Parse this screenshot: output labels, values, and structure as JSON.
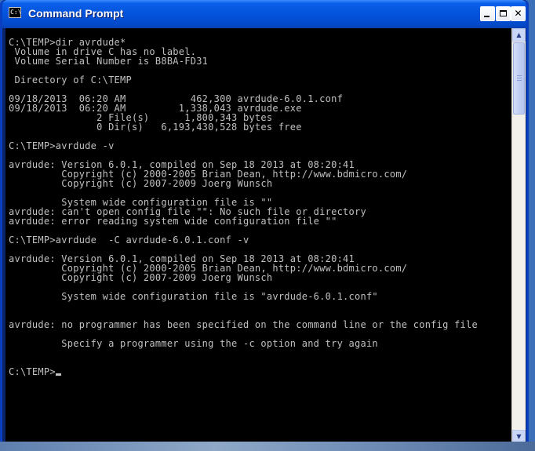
{
  "window": {
    "title": "Command Prompt",
    "icon_name": "cmd-icon",
    "icon_glyph": "C:\\",
    "buttons": {
      "minimize": "minimize-icon",
      "maximize": "maximize-icon",
      "close": "close-icon",
      "close_glyph": "✕"
    }
  },
  "console": {
    "foreground": "#c0c0c0",
    "background": "#000000",
    "lines": [
      "C:\\TEMP>dir avrdude*",
      " Volume in drive C has no label.",
      " Volume Serial Number is B8BA-FD31",
      "",
      " Directory of C:\\TEMP",
      "",
      "09/18/2013  06:20 AM           462,300 avrdude-6.0.1.conf",
      "09/18/2013  06:20 AM         1,338,043 avrdude.exe",
      "               2 File(s)      1,800,343 bytes",
      "               0 Dir(s)   6,193,430,528 bytes free",
      "",
      "C:\\TEMP>avrdude -v",
      "",
      "avrdude: Version 6.0.1, compiled on Sep 18 2013 at 08:20:41",
      "         Copyright (c) 2000-2005 Brian Dean, http://www.bdmicro.com/",
      "         Copyright (c) 2007-2009 Joerg Wunsch",
      "",
      "         System wide configuration file is \"\"",
      "avrdude: can't open config file \"\": No such file or directory",
      "avrdude: error reading system wide configuration file \"\"",
      "",
      "C:\\TEMP>avrdude  -C avrdude-6.0.1.conf -v",
      "",
      "avrdude: Version 6.0.1, compiled on Sep 18 2013 at 08:20:41",
      "         Copyright (c) 2000-2005 Brian Dean, http://www.bdmicro.com/",
      "         Copyright (c) 2007-2009 Joerg Wunsch",
      "",
      "         System wide configuration file is \"avrdude-6.0.1.conf\"",
      "",
      "",
      "avrdude: no programmer has been specified on the command line or the config file",
      "",
      "         Specify a programmer using the -c option and try again",
      "",
      "",
      "C:\\TEMP>"
    ]
  },
  "scrollbar": {
    "up_glyph": "▲",
    "down_glyph": "▼"
  }
}
